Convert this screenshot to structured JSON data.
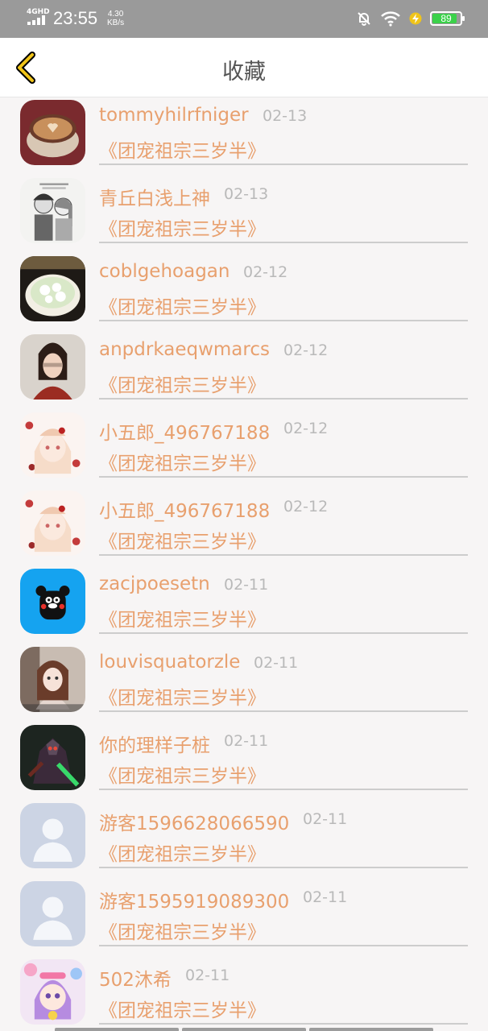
{
  "status_bar": {
    "network": "4GHD",
    "time": "23:55",
    "speed_value": "4.30",
    "speed_unit": "KB/s",
    "battery_level": "89",
    "battery_fraction": 0.89,
    "battery_color": "#3bd14a",
    "icons": [
      "signal-icon",
      "mute-bell-icon",
      "wifi-icon",
      "charging-icon",
      "battery-icon"
    ]
  },
  "header": {
    "title": "收藏",
    "back_icon": "chevron-left-icon",
    "back_color": "#f0c419"
  },
  "list": {
    "items": [
      {
        "name": "tommyhilrfniger",
        "date": "02-13",
        "book": "《团宠祖宗三岁半》",
        "avatar": "coffee-cup"
      },
      {
        "name": "青丘白浅上神",
        "date": "02-13",
        "book": "《团宠祖宗三岁半》",
        "avatar": "sketch-couple"
      },
      {
        "name": "coblgehoagan",
        "date": "02-12",
        "book": "《团宠祖宗三岁半》",
        "avatar": "dessert-bowl"
      },
      {
        "name": "anpdrkaeqwmarcs",
        "date": "02-12",
        "book": "《团宠祖宗三岁半》",
        "avatar": "girl-photo"
      },
      {
        "name": "小五郎_496767188",
        "date": "02-12",
        "book": "《团宠祖宗三岁半》",
        "avatar": "anime-girl"
      },
      {
        "name": "小五郎_496767188",
        "date": "02-12",
        "book": "《团宠祖宗三岁半》",
        "avatar": "anime-girl"
      },
      {
        "name": "zacjpoesetn",
        "date": "02-11",
        "book": "《团宠祖宗三岁半》",
        "avatar": "kumamon-bear"
      },
      {
        "name": "louvisquatorzle",
        "date": "02-11",
        "book": "《团宠祖宗三岁半》",
        "avatar": "girl-selfie"
      },
      {
        "name": "你的理样子桩",
        "date": "02-11",
        "book": "《团宠祖宗三岁半》",
        "avatar": "game-character"
      },
      {
        "name": "游客1596628066590",
        "date": "02-11",
        "book": "《团宠祖宗三岁半》",
        "avatar": "default-person"
      },
      {
        "name": "游客1595919089300",
        "date": "02-11",
        "book": "《团宠祖宗三岁半》",
        "avatar": "default-person"
      },
      {
        "name": "502沐希",
        "date": "02-11",
        "book": "《团宠祖宗三岁半》",
        "avatar": "cartoon-girl"
      }
    ]
  },
  "colors": {
    "accent": "#e8a06e",
    "date": "#b9b9b9",
    "background": "#f7f5f5"
  }
}
